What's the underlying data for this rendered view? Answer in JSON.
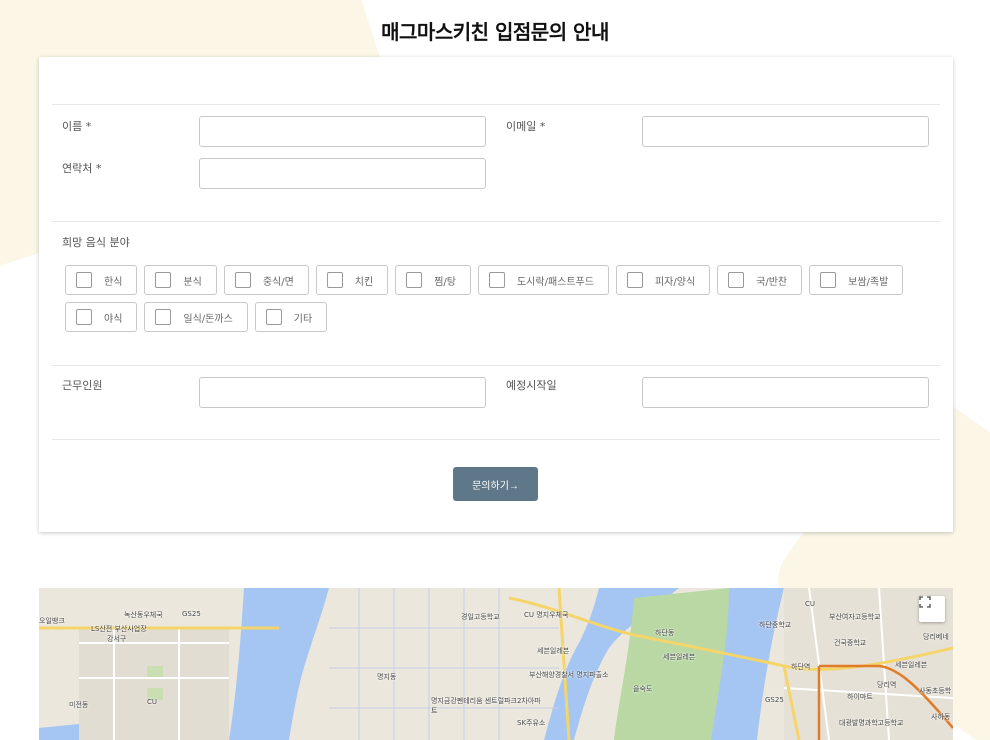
{
  "title": "매그마스키친 입점문의 안내",
  "form": {
    "name_label": "이름 *",
    "email_label": "이메일 *",
    "phone_label": "연락처 *",
    "food_label": "희망 음식 분야",
    "food_options": [
      "한식",
      "분식",
      "중식/면",
      "치킨",
      "찜/탕",
      "도시락/패스트푸드",
      "피자/양식",
      "국/반찬",
      "보쌈/족발",
      "야식",
      "일식/돈까스",
      "기타"
    ],
    "staff_label": "근무인원",
    "start_label": "예정시작일",
    "submit_label": "문의하기→"
  },
  "map": {
    "labels": [
      "오일뱅크",
      "녹산동우체국",
      "GS25",
      "LS산전 부산사업장",
      "강서구",
      "CU",
      "미전동",
      "CU 명지우체국",
      "경일고등학교",
      "명지동",
      "세븐일레븐",
      "부산해양경찰서 명지파출소",
      "명지금강펜테리움 센트럴파크2차아파트",
      "SK주유소",
      "하단동",
      "세븐일레븐",
      "을숙도",
      "CU",
      "하단중학교",
      "부산여자고등학교",
      "건국중학교",
      "당리베네",
      "하단역",
      "세븐일레븐",
      "당리역",
      "하이마트",
      "사동초등학",
      "GS25",
      "대광발명과학고등학교",
      "사하동"
    ],
    "fullscreen_icon": "fullscreen-icon"
  }
}
